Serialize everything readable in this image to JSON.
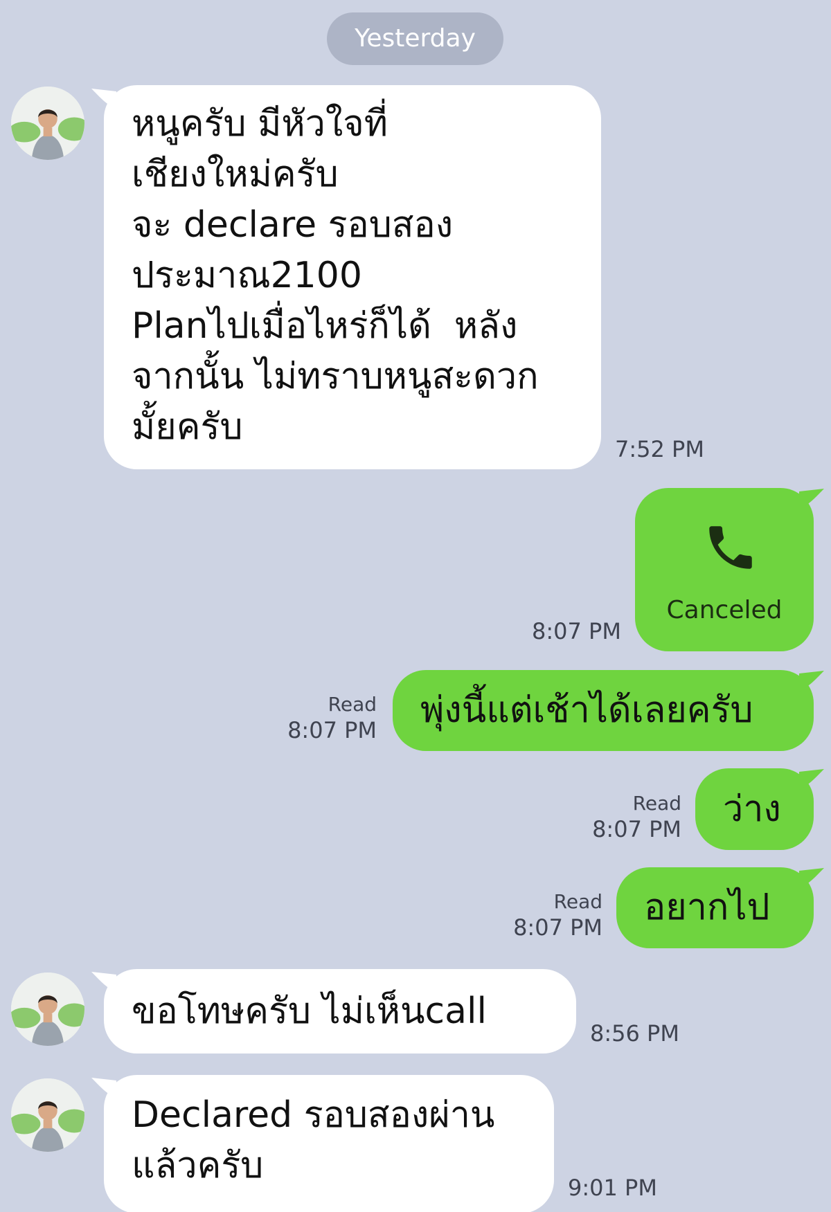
{
  "date_divider": "Yesterday",
  "messages": [
    {
      "text": "หนูครับ มีหัวใจที่\nเชียงใหม่ครับ\nจะ declare รอบสอง\nประมาณ2100\nPlanไปเมื่อไหร่ก็ได้  หลัง\nจากนั้น ไม่ทราบหนูสะดวก\nมั้ยครับ",
      "time": "7:52 PM"
    },
    {
      "call_label": "Canceled",
      "time": "8:07 PM"
    },
    {
      "text": "พุ่งนี้แต่เช้าได้เลยครับ",
      "status": "Read",
      "time": "8:07 PM"
    },
    {
      "text": "ว่าง",
      "status": "Read",
      "time": "8:07 PM"
    },
    {
      "text": "อยากไป",
      "status": "Read",
      "time": "8:07 PM"
    },
    {
      "text": "ขอโทษครับ ไม่เห็นcall",
      "time": "8:56 PM"
    },
    {
      "text": "Declared รอบสองผ่าน\nแล้วครับ",
      "time": "9:01 PM"
    }
  ],
  "colors": {
    "background": "#cdd3e3",
    "incoming_bubble": "#ffffff",
    "outgoing_bubble": "#6fd43f",
    "date_pill": "#adb4c6"
  },
  "icons": {
    "avatar": "contact-avatar",
    "call": "phone-icon"
  }
}
